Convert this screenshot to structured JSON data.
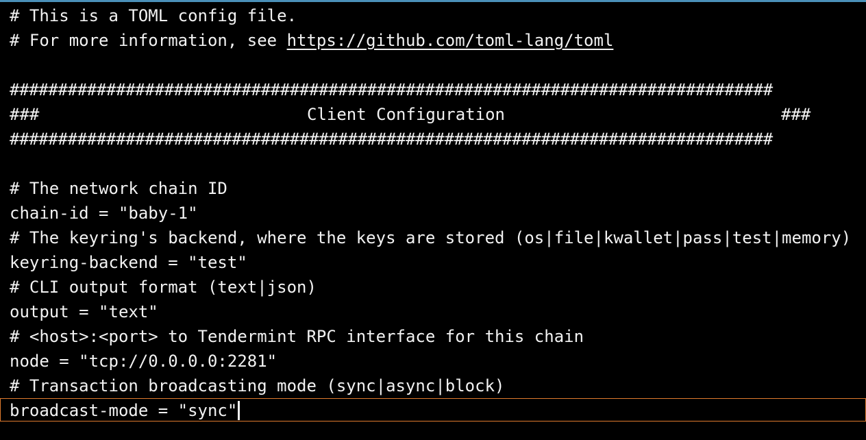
{
  "window": {
    "accent_color": "#4a90b8",
    "active_line_border_color": "#e07b2e",
    "text_color": "#f2f2f2",
    "background_color": "#000000"
  },
  "lines": {
    "comment_1": "# This is a TOML config file.",
    "comment_2_prefix": "# For more information, see ",
    "comment_2_link": "https://github.com/toml-lang/toml",
    "hash_bar_top": "###############################################################################",
    "banner_left": "###",
    "banner_title": "Client Configuration",
    "banner_right": "###",
    "hash_bar_bottom": "###############################################################################",
    "chain_comment": "# The network chain ID",
    "chain_id": "chain-id = \"baby-1\"",
    "keyring_comment": "# The keyring's backend, where the keys are stored (os|file|kwallet|pass|test|memory)",
    "keyring_backend": "keyring-backend = \"test\"",
    "output_comment": "# CLI output format (text|json)",
    "output": "output = \"text\"",
    "node_comment": "# <host>:<port> to Tendermint RPC interface for this chain",
    "node": "node = \"tcp://0.0.0.0:2281\"",
    "broadcast_comment": "# Transaction broadcasting mode (sync|async|block)",
    "broadcast_mode": "broadcast-mode = \"sync\""
  }
}
